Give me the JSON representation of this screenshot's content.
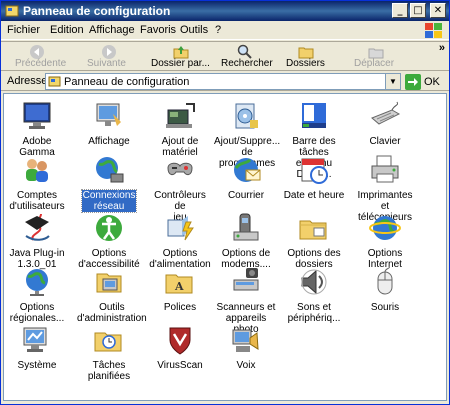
{
  "window": {
    "title": "Panneau de configuration"
  },
  "menu": [
    "Fichier",
    "Edition",
    "Affichage",
    "Favoris",
    "Outils",
    "?"
  ],
  "toolbar": {
    "back": "Précédente",
    "forward": "Suivante",
    "up": "Dossier par...",
    "search": "Rechercher",
    "folders": "Dossiers",
    "move": "Déplacer"
  },
  "address": {
    "label": "Adresse",
    "value": "Panneau de configuration",
    "go": "OK"
  },
  "items": [
    {
      "line1": "Adobe Gamma",
      "line2": "",
      "icon": "monitor-icon"
    },
    {
      "line1": "Affichage",
      "line2": "",
      "icon": "display-icon"
    },
    {
      "line1": "Ajout de",
      "line2": "matériel",
      "icon": "add-hardware-icon"
    },
    {
      "line1": "Ajout/Suppre...",
      "line2": "de programmes",
      "icon": "add-remove-programs-icon"
    },
    {
      "line1": "Barre des tâches",
      "line2": "et menu Déma...",
      "icon": "taskbar-icon"
    },
    {
      "line1": "Clavier",
      "line2": "",
      "icon": "keyboard-icon"
    },
    {
      "line1": "Comptes",
      "line2": "d'utilisateurs",
      "icon": "users-icon"
    },
    {
      "line1": "Connexions",
      "line2": "réseau",
      "icon": "network-icon"
    },
    {
      "line1": "Contrôleurs de",
      "line2": "jeu",
      "icon": "game-controller-icon"
    },
    {
      "line1": "Courrier",
      "line2": "",
      "icon": "mail-icon"
    },
    {
      "line1": "Date et heure",
      "line2": "",
      "icon": "date-time-icon"
    },
    {
      "line1": "Imprimantes et",
      "line2": "télécopieurs",
      "icon": "printer-icon"
    },
    {
      "line1": "Java Plug-in",
      "line2": "1.3.0_01",
      "icon": "java-icon"
    },
    {
      "line1": "Options",
      "line2": "d'accessibilité",
      "icon": "accessibility-icon"
    },
    {
      "line1": "Options",
      "line2": "d'alimentation",
      "icon": "power-icon"
    },
    {
      "line1": "Options de",
      "line2": "modems....",
      "icon": "modem-icon"
    },
    {
      "line1": "Options des",
      "line2": "dossiers",
      "icon": "folder-options-icon"
    },
    {
      "line1": "Options Internet",
      "line2": "",
      "icon": "internet-icon"
    },
    {
      "line1": "Options",
      "line2": "régionales...",
      "icon": "globe-icon"
    },
    {
      "line1": "Outils",
      "line2": "d'administration",
      "icon": "admin-tools-icon"
    },
    {
      "line1": "Polices",
      "line2": "",
      "icon": "fonts-icon"
    },
    {
      "line1": "Scanneurs et",
      "line2": "appareils photo",
      "icon": "scanner-icon"
    },
    {
      "line1": "Sons et",
      "line2": "périphériq...",
      "icon": "sound-icon"
    },
    {
      "line1": "Souris",
      "line2": "",
      "icon": "mouse-icon"
    },
    {
      "line1": "Système",
      "line2": "",
      "icon": "system-icon"
    },
    {
      "line1": "Tâches",
      "line2": "planifiées",
      "icon": "scheduled-tasks-icon"
    },
    {
      "line1": "VirusScan",
      "line2": "",
      "icon": "virusscan-icon"
    },
    {
      "line1": "Voix",
      "line2": "",
      "icon": "speech-icon"
    }
  ],
  "selected_item": "Connexions réseau"
}
